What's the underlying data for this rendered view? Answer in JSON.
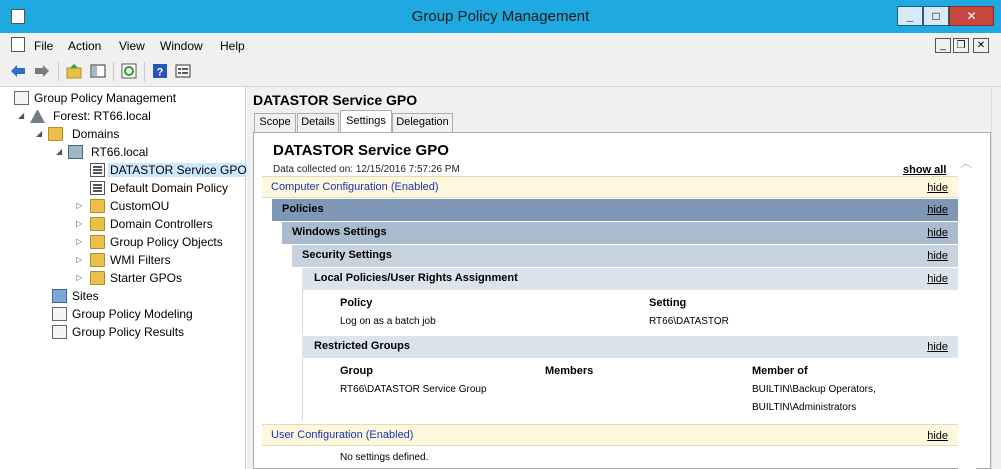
{
  "window": {
    "title": "Group Policy Management",
    "min_label": "_",
    "max_label": "□",
    "close_label": "✕"
  },
  "menu": [
    "File",
    "Action",
    "View",
    "Window",
    "Help"
  ],
  "mdi": {
    "min": "_",
    "restore": "❐",
    "close": "✕"
  },
  "toolbar_icons": [
    "back-arrow-icon",
    "forward-arrow-icon",
    "up-folder-icon",
    "show-hide-tree-icon",
    "refresh-icon",
    "help-icon",
    "properties-icon"
  ],
  "tree": [
    {
      "label": "Group Policy Management",
      "icon": "gpm-console-icon",
      "expander": ""
    },
    {
      "label": "Forest: RT66.local",
      "icon": "forest-icon",
      "expander": "◢"
    },
    {
      "label": "Domains",
      "icon": "domains-folder-icon",
      "expander": "◢"
    },
    {
      "label": "RT66.local",
      "icon": "domain-icon",
      "expander": "◢"
    },
    {
      "label": "DATASTOR Service GPO",
      "icon": "gpo-link-icon",
      "expander": "",
      "selected": true
    },
    {
      "label": "Default Domain Policy",
      "icon": "gpo-link-icon",
      "expander": ""
    },
    {
      "label": "CustomOU",
      "icon": "ou-folder-icon",
      "expander": "▷"
    },
    {
      "label": "Domain Controllers",
      "icon": "ou-folder-icon",
      "expander": "▷"
    },
    {
      "label": "Group Policy Objects",
      "icon": "gpo-folder-icon",
      "expander": "▷"
    },
    {
      "label": "WMI Filters",
      "icon": "wmi-folder-icon",
      "expander": "▷"
    },
    {
      "label": "Starter GPOs",
      "icon": "starter-folder-icon",
      "expander": "▷"
    },
    {
      "label": "Sites",
      "icon": "sites-icon",
      "expander": ""
    },
    {
      "label": "Group Policy Modeling",
      "icon": "modeling-icon",
      "expander": ""
    },
    {
      "label": "Group Policy Results",
      "icon": "results-icon",
      "expander": ""
    }
  ],
  "pane": {
    "title": "DATASTOR Service GPO",
    "tabs": [
      "Scope",
      "Details",
      "Settings",
      "Delegation"
    ],
    "active_tab": "Settings"
  },
  "report": {
    "title": "DATASTOR Service GPO",
    "collected": "Data collected on: 12/15/2016 7:57:26 PM",
    "show_all": "show all",
    "hide": "hide",
    "computer_config": "Computer Configuration (Enabled)",
    "policies": "Policies",
    "windows_settings": "Windows Settings",
    "security_settings": "Security Settings",
    "local_policies": "Local Policies/User Rights Assignment",
    "policy_header": "Policy",
    "setting_header": "Setting",
    "policy_row": {
      "policy": "Log on as a batch job",
      "setting": "RT66\\DATASTOR"
    },
    "restricted_groups": "Restricted Groups",
    "group_header": "Group",
    "members_header": "Members",
    "member_of_header": "Member of",
    "group_row": {
      "group": "RT66\\DATASTOR Service Group",
      "members": "",
      "member_of_1": "BUILTIN\\Backup Operators,",
      "member_of_2": "BUILTIN\\Administrators"
    },
    "user_config": "User Configuration (Enabled)",
    "no_settings": "No settings defined."
  },
  "colors": {
    "titlebar": "#1fa9e1",
    "policies_bar": "#7e97b5",
    "windows_bar": "#a9bccf",
    "security_bar": "#c7d4e0",
    "subsection_bar": "#dbe3eb",
    "config_bar": "#fdf7dd",
    "link_blue": "#1a33b5"
  }
}
